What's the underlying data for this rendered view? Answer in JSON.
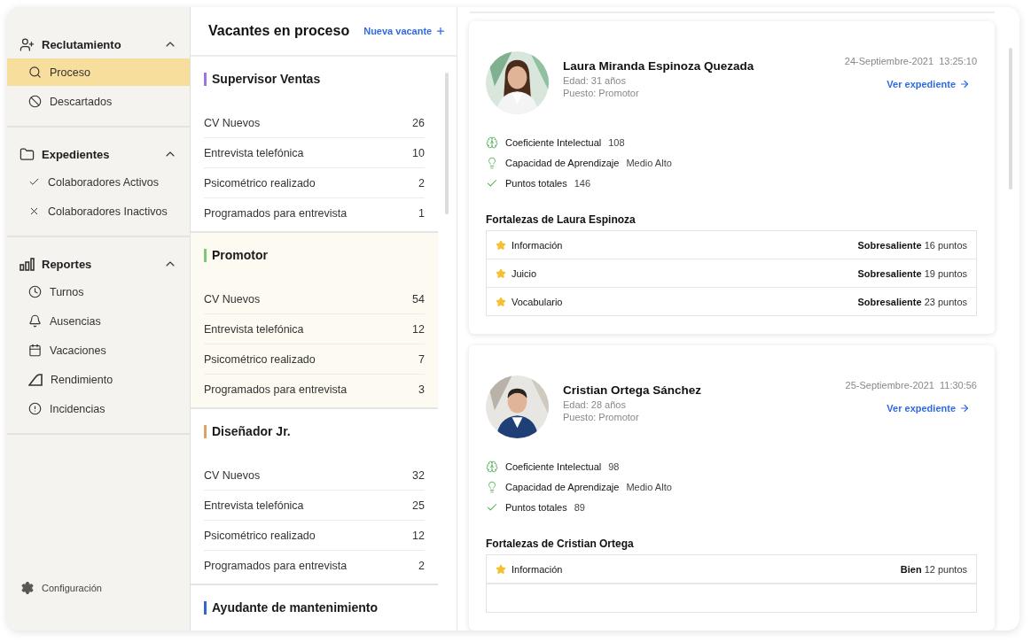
{
  "sidebar": {
    "groups": [
      {
        "label": "Reclutamiento",
        "expanded": true,
        "items": [
          {
            "label": "Proceso",
            "selected": true
          },
          {
            "label": "Descartados",
            "selected": false
          }
        ]
      },
      {
        "label": "Expedientes",
        "expanded": true,
        "items": [
          {
            "label": "Colaboradores Activos",
            "selected": false
          },
          {
            "label": "Colaboradores Inactivos",
            "selected": false
          }
        ]
      },
      {
        "label": "Reportes",
        "expanded": true,
        "items": [
          {
            "label": "Turnos",
            "selected": false
          },
          {
            "label": "Ausencias",
            "selected": false
          },
          {
            "label": "Vacaciones",
            "selected": false
          },
          {
            "label": "Rendimiento",
            "selected": false
          },
          {
            "label": "Incidencias",
            "selected": false
          }
        ]
      }
    ],
    "footer": "Configuración"
  },
  "vacancies": {
    "title": "Vacantes en proceso",
    "new_button": "Nueva vacante",
    "list": [
      {
        "title": "Supervisor Ventas",
        "color": "#a571e0",
        "selected": false,
        "stages": [
          {
            "label": "CV Nuevos",
            "count": "26"
          },
          {
            "label": "Entrevista telefónica",
            "count": "10"
          },
          {
            "label": "Psicométrico realizado",
            "count": "2"
          },
          {
            "label": "Programados para entrevista",
            "count": "1"
          }
        ]
      },
      {
        "title": "Promotor",
        "color": "#7cc77a",
        "selected": true,
        "stages": [
          {
            "label": "CV Nuevos",
            "count": "54"
          },
          {
            "label": "Entrevista telefónica",
            "count": "12"
          },
          {
            "label": "Psicométrico realizado",
            "count": "7"
          },
          {
            "label": "Programados para entrevista",
            "count": "3"
          }
        ]
      },
      {
        "title": "Diseñador Jr.",
        "color": "#dca16d",
        "selected": false,
        "stages": [
          {
            "label": "CV Nuevos",
            "count": "32"
          },
          {
            "label": "Entrevista telefónica",
            "count": "25"
          },
          {
            "label": "Psicométrico realizado",
            "count": "12"
          },
          {
            "label": "Programados para entrevista",
            "count": "2"
          }
        ]
      },
      {
        "title": "Ayudante de mantenimiento",
        "color": "#2f66d0",
        "selected": false
      }
    ]
  },
  "candidates": [
    {
      "name": "Laura Miranda Espinoza Quezada",
      "age": "Edad: 31 años",
      "position": "Puesto: Promotor",
      "date": "24-Septiembre-2021",
      "time": "13:25:10",
      "link": "Ver expediente",
      "stats": [
        {
          "label": "Coeficiente Intelectual",
          "value": "108"
        },
        {
          "label": "Capacidad de Aprendizaje",
          "value": "Medio Alto"
        },
        {
          "label": "Puntos totales",
          "value": "146"
        }
      ],
      "strengths_title": "Fortalezas de Laura Espinoza",
      "strengths": [
        {
          "label": "Información",
          "rating": "**Sobresaliente** 16 puntos"
        },
        {
          "label": "Juicio",
          "rating": "**Sobresaliente** 19 puntos"
        },
        {
          "label": "Vocabulario",
          "rating": "**Sobresaliente** 23 puntos"
        }
      ]
    },
    {
      "name": "Cristian Ortega Sánchez",
      "age": "Edad: 28 años",
      "position": "Puesto: Promotor",
      "date": "25-Septiembre-2021",
      "time": "11:30:56",
      "link": "Ver expediente",
      "stats": [
        {
          "label": "Coeficiente Intelectual",
          "value": "98"
        },
        {
          "label": "Capacidad de Aprendizaje",
          "value": "Medio Alto"
        },
        {
          "label": "Puntos totales",
          "value": "89"
        }
      ],
      "strengths_title": "Fortalezas de Cristian Ortega",
      "strengths": [
        {
          "label": "Información",
          "rating": "**Bien** 12 puntos"
        }
      ]
    }
  ]
}
